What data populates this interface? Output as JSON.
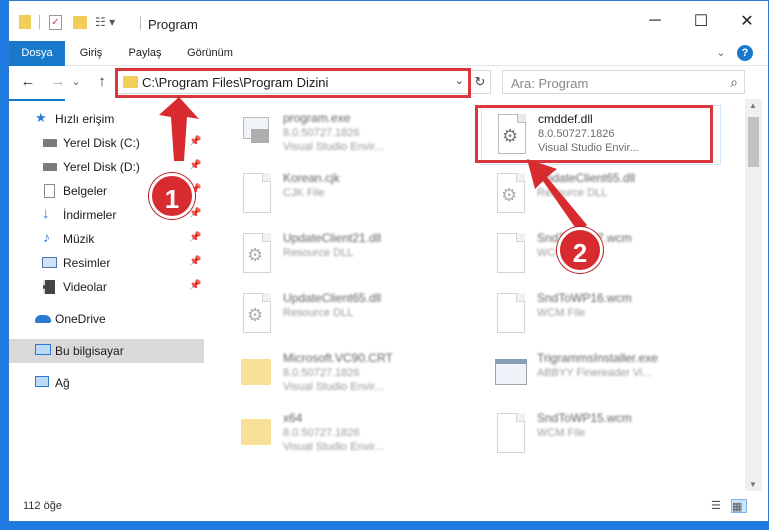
{
  "window": {
    "title": "Program",
    "controls": {
      "minimize": "─",
      "maximize": "☐",
      "close": "✕"
    }
  },
  "ribbon": {
    "tabs": [
      "Dosya",
      "Giriş",
      "Paylaş",
      "Görünüm"
    ],
    "help": "?",
    "collapse": "⌄"
  },
  "nav": {
    "back": "←",
    "forward": "→",
    "dropdown": "⌄",
    "up": "↑",
    "address": "C:\\Program Files\\Program Dizini",
    "address_drop": "⌄",
    "refresh": "↻",
    "search_placeholder": "Ara: Program",
    "search_icon": "⌕"
  },
  "sidebar": {
    "items": [
      {
        "label": "Hızlı erişim",
        "icon": "star-icon",
        "pinned": false
      },
      {
        "label": "Yerel Disk (C:)",
        "icon": "drive-icon",
        "pinned": true
      },
      {
        "label": "Yerel Disk (D:)",
        "icon": "drive-icon",
        "pinned": true
      },
      {
        "label": "Belgeler",
        "icon": "documents-icon",
        "pinned": true
      },
      {
        "label": "İndirmeler",
        "icon": "download-icon",
        "pinned": true
      },
      {
        "label": "Müzik",
        "icon": "music-icon",
        "pinned": true
      },
      {
        "label": "Resimler",
        "icon": "pictures-icon",
        "pinned": true
      },
      {
        "label": "Videolar",
        "icon": "videos-icon",
        "pinned": true
      },
      {
        "label": "OneDrive",
        "icon": "cloud-icon",
        "pinned": false
      },
      {
        "label": "Bu bilgisayar",
        "icon": "computer-icon",
        "pinned": false
      },
      {
        "label": "Ağ",
        "icon": "network-icon",
        "pinned": false
      }
    ]
  },
  "files": [
    {
      "name": "program.exe",
      "sub1": "8.0.50727.1826",
      "sub2": "Visual Studio Envir...",
      "icon": "exe-icon"
    },
    {
      "name": "cmddef.dll",
      "sub1": "8.0.50727.1826",
      "sub2": "Visual Studio Envir...",
      "icon": "dll-icon"
    },
    {
      "name": "Korean.cjk",
      "sub1": "CJK File",
      "sub2": "",
      "icon": "file-icon"
    },
    {
      "name": "UpdateClient65.dll",
      "sub1": "Resource DLL",
      "sub2": "",
      "icon": "dll-icon"
    },
    {
      "name": "UpdateClient21.dll",
      "sub1": "Resource DLL",
      "sub2": "",
      "icon": "dll-icon"
    },
    {
      "name": "SndToWP17.wcm",
      "sub1": "WCM File",
      "sub2": "",
      "icon": "file-icon"
    },
    {
      "name": "UpdateClient65.dll",
      "sub1": "Resource DLL",
      "sub2": "",
      "icon": "dll-icon"
    },
    {
      "name": "SndToWP16.wcm",
      "sub1": "WCM File",
      "sub2": "",
      "icon": "file-icon"
    },
    {
      "name": "Microsoft.VC90.CRT",
      "sub1": "8.0.50727.1826",
      "sub2": "Visual Studio Envir...",
      "icon": "folder-icon"
    },
    {
      "name": "TrigrammsInstaller.exe",
      "sub1": "ABBYY Finereader Vi...",
      "sub2": "",
      "icon": "exe-icon"
    },
    {
      "name": "x64",
      "sub1": "8.0.50727.1826",
      "sub2": "Visual Studio Envir...",
      "icon": "folder-icon"
    },
    {
      "name": "SndToWP15.wcm",
      "sub1": "WCM File",
      "sub2": "",
      "icon": "file-icon"
    }
  ],
  "status": {
    "count": "112 öğe"
  },
  "callouts": {
    "one": "1",
    "two": "2"
  },
  "colors": {
    "accent": "#1979ca",
    "highlight": "#d9363e",
    "folder": "#f4cc57"
  }
}
